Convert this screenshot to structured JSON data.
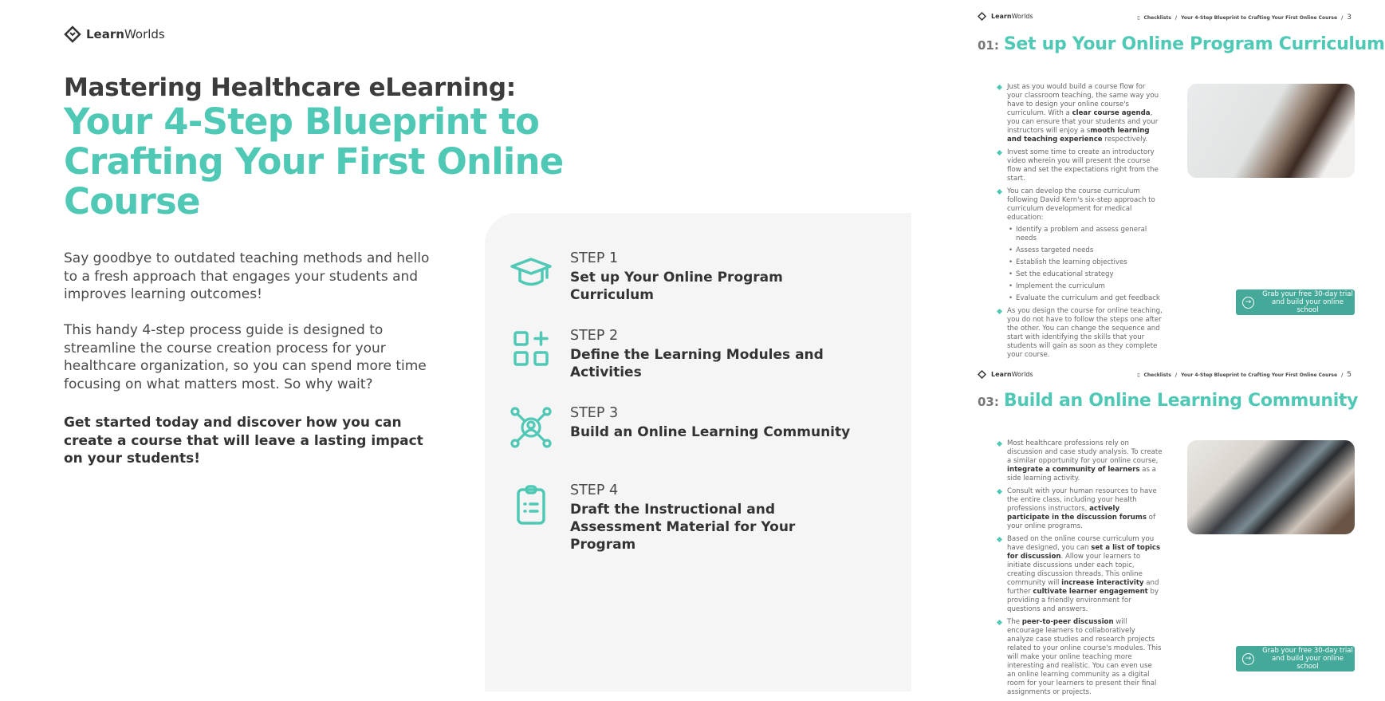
{
  "brand": {
    "name_bold": "Learn",
    "name_light": "Worlds"
  },
  "cover": {
    "title": "Mastering Healthcare eLearning:",
    "subtitle": "Your 4-Step Blueprint to Crafting Your First Online Course",
    "para1": "Say goodbye to outdated teaching methods and hello to a fresh approach that engages your students and improves learning outcomes!",
    "para2": "This handy 4-step process guide is designed to streamline the course creation process for your healthcare organization, so you can spend more time focusing on what matters most. So why wait?",
    "para3": "Get started today and discover how you can create a course that will leave a lasting impact on your students!",
    "steps": [
      {
        "label": "STEP 1",
        "title": "Set up Your Online Program Curriculum",
        "icon": "graduation-cap-icon"
      },
      {
        "label": "STEP 2",
        "title": "Define the Learning Modules and Activities",
        "icon": "modules-grid-icon"
      },
      {
        "label": "STEP 3",
        "title": "Build an Online Learning Community",
        "icon": "community-network-icon"
      },
      {
        "label": "STEP 4",
        "title": "Draft the Instructional and Assessment Material for Your Program",
        "icon": "clipboard-icon"
      }
    ]
  },
  "colors": {
    "accent": "#4fc9b5",
    "button": "#45a99a",
    "panel": "#f5f5f5"
  },
  "pages": [
    {
      "crumb_section": "Checklists",
      "crumb_title": "Your 4-Step Blueprint to Crafting Your First Online Course",
      "page_number": "3",
      "heading_number": "01:",
      "heading": "Set up Your Online Program Curriculum",
      "bullets": [
        {
          "segments": [
            {
              "t": "Just as you would build a course flow for your classroom teaching, the same way you have to design your online course's curriculum. With a "
            },
            {
              "t": "clear course agenda",
              "b": true
            },
            {
              "t": ", you can ensure that your students and your instructors will enjoy a s"
            },
            {
              "t": "mooth learning and teaching experience",
              "b": true
            },
            {
              "t": " respectively."
            }
          ]
        },
        {
          "segments": [
            {
              "t": "Invest some time to create an introductory video wherein you will present the course flow and set the expectations right from the start."
            }
          ]
        },
        {
          "segments": [
            {
              "t": "You can develop the course curriculum following David Kern's six-step approach to curriculum development for medical education:"
            }
          ],
          "sub": [
            "Identify a problem and assess general needs",
            "Assess targeted needs",
            "Establish the learning objectives",
            "Set the educational strategy",
            "Implement the curriculum",
            "Evaluate the curriculum and get feedback"
          ]
        },
        {
          "segments": [
            {
              "t": "As you design the course for online teaching, you do not have to follow the steps one after the other. You can change the sequence and start with identifying the skills that your students will gain as soon as they complete your course."
            }
          ]
        }
      ],
      "cta": "Grab your free 30-day trial and build your online school"
    },
    {
      "crumb_section": "Checklists",
      "crumb_title": "Your 4-Step Blueprint to Crafting Your First Online Course",
      "page_number": "5",
      "heading_number": "03:",
      "heading": "Build an Online Learning Community",
      "bullets": [
        {
          "segments": [
            {
              "t": "Most healthcare professions rely on discussion and case study analysis. To create a similar opportunity for your online course, "
            },
            {
              "t": "integrate a community of learners",
              "b": true
            },
            {
              "t": " as a side learning activity."
            }
          ]
        },
        {
          "segments": [
            {
              "t": "Consult with your human resources to have the entire class, including your health professions instructors, "
            },
            {
              "t": "actively participate in the discussion forums",
              "b": true
            },
            {
              "t": " of your online programs."
            }
          ]
        },
        {
          "segments": [
            {
              "t": "Based on the online course curriculum you have designed, you can "
            },
            {
              "t": "set a list of topics for discussion",
              "b": true
            },
            {
              "t": ". Allow your learners to initiate discussions under each topic, creating discussion threads. This online community will "
            },
            {
              "t": "increase interactivity",
              "b": true
            },
            {
              "t": " and further "
            },
            {
              "t": "cultivate learner engagement",
              "b": true
            },
            {
              "t": " by providing a friendly environment for questions and answers."
            }
          ]
        },
        {
          "segments": [
            {
              "t": "The "
            },
            {
              "t": "peer-to-peer discussion",
              "b": true
            },
            {
              "t": " will encourage learners to collaboratively analyze case studies and research projects related to your online course's modules. This will make your online teaching more interesting and realistic. You can even use an online learning community as a digital room for your learners to present their final assignments or projects."
            }
          ]
        }
      ],
      "cta": "Grab your free 30-day trial and build your online school"
    }
  ]
}
